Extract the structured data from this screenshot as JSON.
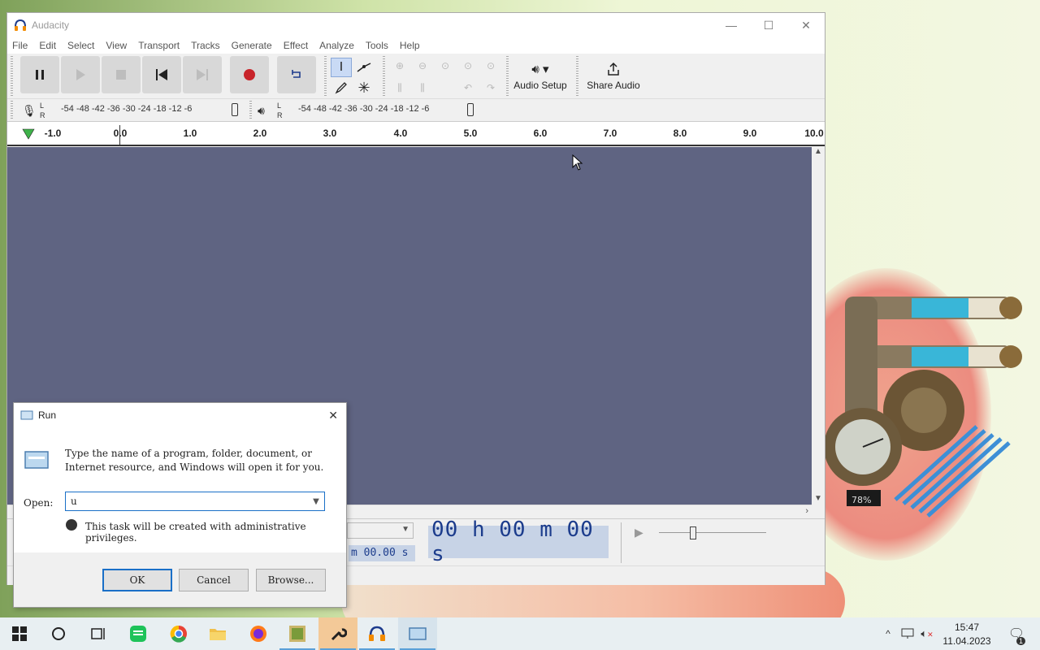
{
  "window": {
    "title": "Audacity",
    "controls": {
      "minimize": "—",
      "maximize": "☐",
      "close": "✕"
    }
  },
  "menu": [
    "File",
    "Edit",
    "Select",
    "View",
    "Transport",
    "Tracks",
    "Generate",
    "Effect",
    "Analyze",
    "Tools",
    "Help"
  ],
  "toolbar": {
    "audio_setup_label": "Audio Setup",
    "share_audio_label": "Share Audio"
  },
  "meters": {
    "record_scale": "-54 -48 -42 -36 -30 -24 -18 -12 -6",
    "play_scale": "-54 -48 -42 -36 -30 -24 -18 -12 -6",
    "l": "L",
    "r": "R"
  },
  "ruler": {
    "labels": [
      "-1.0",
      "0.0",
      "1.0",
      "2.0",
      "3.0",
      "4.0",
      "5.0",
      "6.0",
      "7.0",
      "8.0",
      "9.0",
      "10.0"
    ]
  },
  "selection": {
    "time_display": "00 h 00 m 00 s",
    "small_time": "m 00.00 s"
  },
  "run_dialog": {
    "title": "Run",
    "description": "Type the name of a program, folder, document, or Internet resource, and Windows will open it for you.",
    "open_label": "Open:",
    "input_value": "u",
    "admin_note": "This task will be created with administrative privileges.",
    "ok_label": "OK",
    "cancel_label": "Cancel",
    "browse_label": "Browse..."
  },
  "widget": {
    "percent": "78%"
  },
  "taskbar": {
    "time": "15:47",
    "date": "11.04.2023",
    "notification_count": "1"
  }
}
